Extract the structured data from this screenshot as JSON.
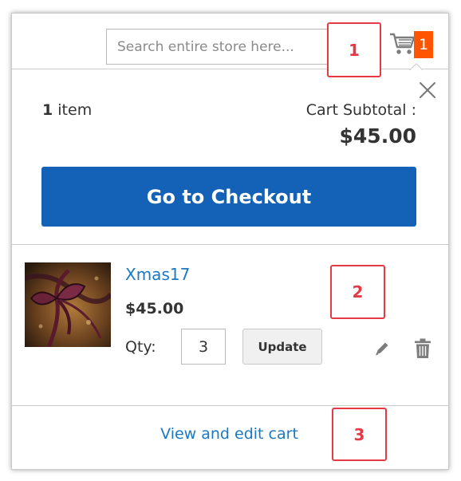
{
  "search": {
    "placeholder": "Search entire store here..."
  },
  "callouts": {
    "one": "1",
    "two": "2",
    "three": "3"
  },
  "cart": {
    "badge_count": "1",
    "icon": "cart-icon",
    "badge_color": "#ff5501"
  },
  "minicart": {
    "close_icon": "close-icon",
    "item_count": "1",
    "item_word": "item",
    "subtotal_label": "Cart Subtotal :",
    "subtotal_amount": "$45.00",
    "checkout_label": "Go to Checkout",
    "checkout_color": "#1462b8",
    "product": {
      "name": "Xmas17",
      "price": "$45.00",
      "qty_label": "Qty:",
      "qty_value": "3",
      "update_label": "Update",
      "edit_icon": "pencil-icon",
      "delete_icon": "trash-icon"
    },
    "view_cart_label": "View and edit cart",
    "link_color": "#1979c3"
  },
  "callout_color": "#e63946"
}
